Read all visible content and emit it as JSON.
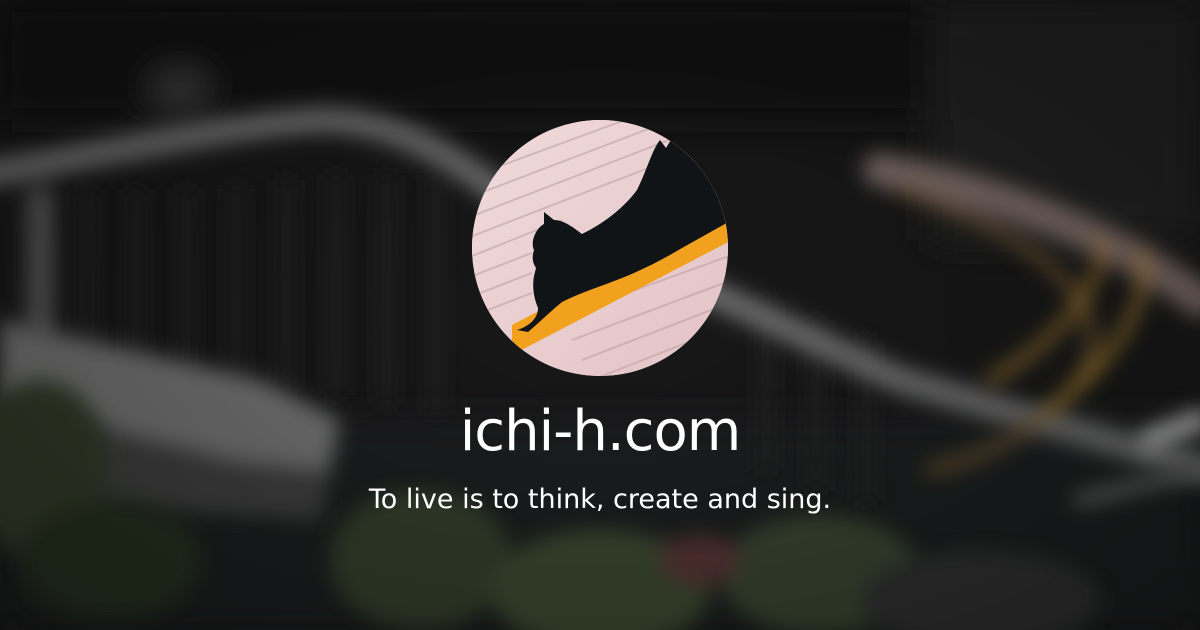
{
  "site": {
    "title": "ichi-h.com",
    "tagline": "To live is to think, create and sing."
  },
  "avatar": {
    "description_icon": "cat-silhouette-on-book-icon"
  },
  "colors": {
    "background": "#1c1c1c",
    "text": "#ffffff",
    "accent_orange": "#f2a11f",
    "page_pink": "#e8cfd1",
    "cat_black": "#111417"
  }
}
